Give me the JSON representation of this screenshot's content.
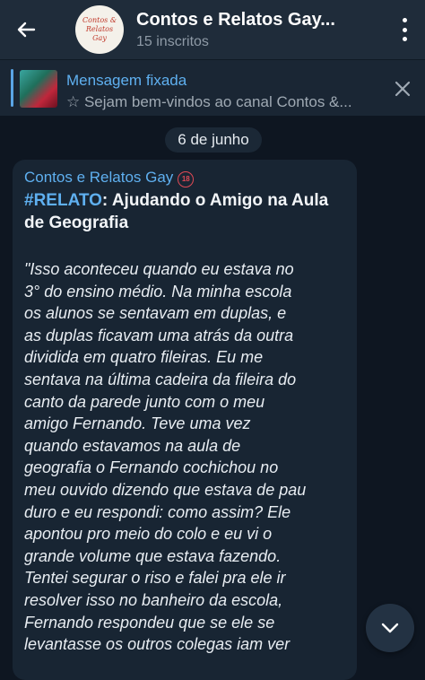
{
  "header": {
    "back_icon": "arrow-left-icon",
    "channel_title": "Contos e Relatos Gay...",
    "subscribers": "15 inscritos",
    "avatar_text_line1": "Contos & Relatos",
    "avatar_text_line2": "Gay",
    "menu_icon": "more-vertical-icon"
  },
  "pinned": {
    "label": "Mensagem fixada",
    "text": "☆ Sejam bem-vindos ao canal Contos &...",
    "close_icon": "close-icon"
  },
  "date_chip": "6 de junho",
  "message": {
    "sender": "Contos e Relatos Gay",
    "age_badge": "18",
    "hashtag": "#RELATO",
    "title_rest": ": Ajudando o Amigo na Aula",
    "title_line2": "de Geografia",
    "lines": [
      "\"Isso aconteceu quando eu estava no",
      "3° do ensino médio. Na minha escola",
      "os alunos se sentavam em duplas, e",
      "as duplas ficavam uma atrás da outra",
      "dividida em quatro fileiras. Eu me",
      "sentava na última cadeira da fileira do",
      "canto da parede junto com o meu",
      "amigo Fernando. Teve uma vez",
      "quando estavamos na aula de",
      "geografia o Fernando cochichou no",
      "meu ouvido dizendo que estava de pau",
      "duro e eu respondi: como assim? Ele",
      "apontou pro meio do colo e eu vi o",
      "grande volume que estava fazendo.",
      "Tentei segurar o riso e falei pra ele ir",
      "resolver isso no banheiro da escola,",
      "Fernando respondeu que se ele se",
      "levantasse os outros colegas iam ver"
    ]
  },
  "scroll_button_icon": "chevron-down-icon",
  "colors": {
    "background": "#0e1621",
    "header": "#1f2c3a",
    "bubble": "#182533",
    "accent": "#5fb0f0"
  }
}
